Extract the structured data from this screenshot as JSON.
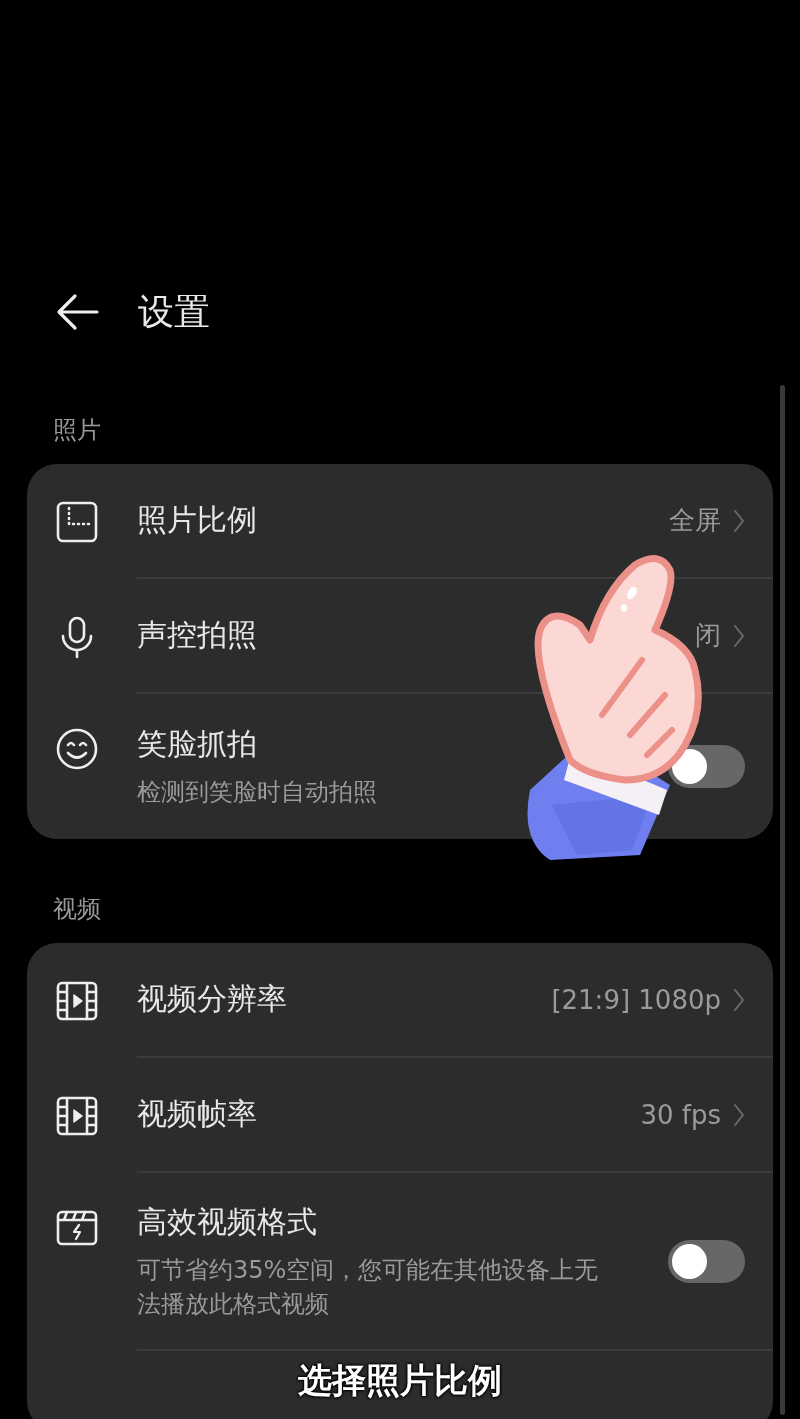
{
  "header": {
    "title": "设置"
  },
  "sections": [
    {
      "title": "照片",
      "items": [
        {
          "kind": "link",
          "label": "照片比例",
          "value": "全屏"
        },
        {
          "kind": "link",
          "label": "声控拍照",
          "value": "闭"
        },
        {
          "kind": "toggle",
          "label": "笑脸抓拍",
          "description": "检测到笑脸时自动拍照",
          "on": false
        }
      ]
    },
    {
      "title": "视频",
      "items": [
        {
          "kind": "link",
          "label": "视频分辨率",
          "value": "[21:9] 1080p"
        },
        {
          "kind": "link",
          "label": "视频帧率",
          "value": "30 fps"
        },
        {
          "kind": "toggle",
          "label": "高效视频格式",
          "description": "可节省约35%空间，您可能在其他设备上无法播放此格式视频",
          "on": false
        }
      ]
    }
  ],
  "caption": "选择照片比例"
}
